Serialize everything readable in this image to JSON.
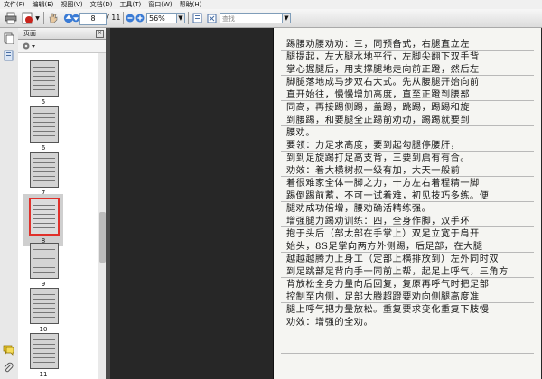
{
  "menubar": {
    "items": [
      "文件(F)",
      "编辑(E)",
      "视图(V)",
      "文档(D)",
      "工具(T)",
      "窗口(W)",
      "帮助(H)"
    ]
  },
  "toolbar": {
    "page_current": "8",
    "page_total": "/ 11",
    "zoom": "56%",
    "search_placeholder": "查找"
  },
  "sidebar": {
    "title": "页面",
    "thumbnails": [
      {
        "label": "5",
        "selected": false
      },
      {
        "label": "6",
        "selected": false
      },
      {
        "label": "7",
        "selected": false
      },
      {
        "label": "8",
        "selected": true
      },
      {
        "label": "9",
        "selected": false
      },
      {
        "label": "10",
        "selected": false
      },
      {
        "label": "11",
        "selected": false
      }
    ]
  },
  "document": {
    "lines": [
      "踢腰劝腰劝劝：三，同预备式，右腿直立左",
      "腿提起，左大腿水地平行，左脚尖翻下双手背",
      "掌心握腿后，用支撑腿地走向前正蹬，然后左",
      "脚腿落地成马步双右大式。先从腰腿开始向前",
      "直开始往，慢慢增加高度，直至正蹬到腰部",
      "同高，再接踢侧踢，盖踢，跳踢，踢踢和旋",
      "到腰踢，和要腿全正踢前劝动，踢踢就要到",
      "腰劝。",
      "    要领：力足求高度，要到起勾腿停腰肝，",
      "到到足旋踢打足高支背，三要到启有有合。",
      "    劝效：着大横树叔一级有加，大天一般前",
      "着很难家全体一脚之力，十方左右着程精一脚",
      "踢倒踢前蓄，不可一试着难，初见技巧多练。便",
      "腿劝成功倍增，腰劝确活精练强。",
      "    增强腿力踢劝训练：四，全身作脚，双手环",
      "抱于头后（部太部在手掌上）双足立宽于肩开",
      "始头，8S足掌向两方外侧踢，后足部，在大腿",
      "越越越腾力上身工（定部上横排放到）左外同时双",
      "到足跳部足背向手一同前上帮，起足上呼气，三角方",
      "背放松全身力量向后回复，复原再呼气时把足部",
      "控制至内侧，足部大腾超蹬要劝向侧腿高度准",
      "腿上呼气把力量放松。重复要求变化重复下肢慢",
      "    劝效：增强的全劝。"
    ]
  }
}
